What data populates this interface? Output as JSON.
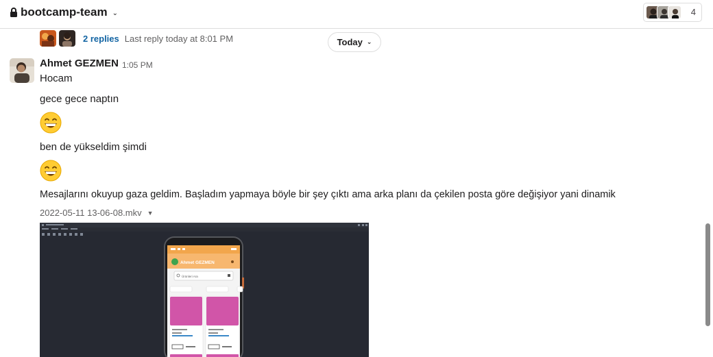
{
  "header": {
    "channel_name": "bootcamp-team",
    "member_count": "4"
  },
  "thread": {
    "replies_label": "2 replies",
    "last_reply": "Last reply today at 8:01 PM"
  },
  "date_divider": {
    "label": "Today"
  },
  "message": {
    "sender": "Ahmet GEZMEN",
    "time": "1:05 PM",
    "lines": [
      "Hocam",
      "gece gece naptın",
      "ben de yükseldim şimdi",
      "Mesajlarını okuyup gaza geldim. Başladım yapmaya böyle bir şey çıktı ama arka planı da çekilen posta göre değişiyor yani dinamik"
    ],
    "emoji": "grinning-face-with-smiling-eyes",
    "attachment": {
      "file_name": "2022-05-11 13-06-08.mkv"
    }
  },
  "video_preview": {
    "app_title": "Ahmet GEZMEN",
    "search_placeholder": "Ürünleri Ara",
    "status_time": "13:00",
    "chips": [
      "Ekle",
      "Sale",
      "Sale"
    ],
    "cards": [
      {
        "date": "17th July 2022",
        "title": "Sweaty",
        "location": "Cumaray Istanbul"
      },
      {
        "date": "17th July 2022",
        "title": "Sweaty",
        "location": "Cumaray Istanbul"
      }
    ],
    "card_meta": [
      "T0 Bilgiler",
      "T0 Bilgiler"
    ]
  },
  "colors": {
    "link": "#1264a3",
    "appbar": "#f7b76f",
    "card": "#d155a8",
    "video_bg": "#262932"
  }
}
